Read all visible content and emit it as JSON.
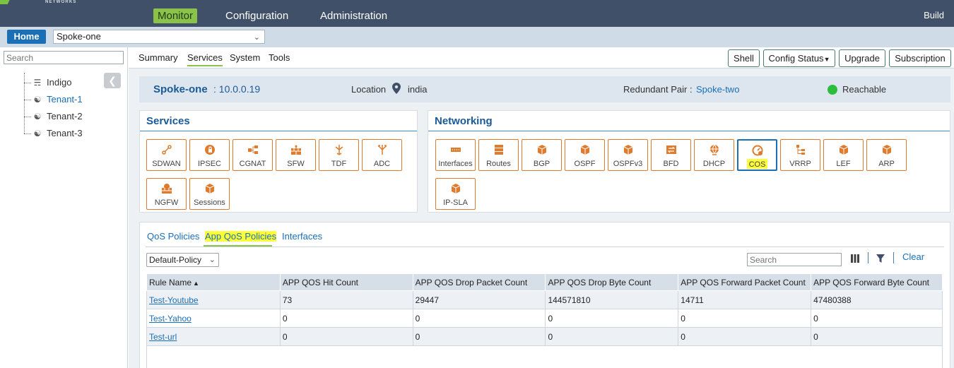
{
  "brand": {
    "logo_text": "NETWORKS",
    "accent": "#8bc34a",
    "logo_color": "#7cc242"
  },
  "topnav": {
    "items": [
      {
        "label": "Monitor",
        "active": true
      },
      {
        "label": "Configuration",
        "active": false
      },
      {
        "label": "Administration",
        "active": false
      }
    ],
    "build_label": "Build"
  },
  "homerow": {
    "home_label": "Home",
    "device_selected": "Spoke-one"
  },
  "tree": {
    "search_placeholder": "Search",
    "items": [
      {
        "label": "Indigo",
        "icon": "org-icon",
        "selected": false
      },
      {
        "label": "Tenant-1",
        "icon": "tenant-icon",
        "selected": true
      },
      {
        "label": "Tenant-2",
        "icon": "tenant-icon",
        "selected": false
      },
      {
        "label": "Tenant-3",
        "icon": "tenant-icon",
        "selected": false
      }
    ]
  },
  "subnav": {
    "tabs": [
      {
        "label": "Summary",
        "active": false
      },
      {
        "label": "Services",
        "active": true
      },
      {
        "label": "System",
        "active": false
      },
      {
        "label": "Tools",
        "active": false
      }
    ],
    "buttons": {
      "shell": "Shell",
      "config_status": "Config Status",
      "upgrade": "Upgrade",
      "subscription": "Subscription"
    }
  },
  "device": {
    "name": "Spoke-one",
    "ip": ": 10.0.0.19",
    "location_label": "Location",
    "location": "india",
    "redundant_label": "Redundant Pair :",
    "redundant_pair": "Spoke-two",
    "status": "Reachable",
    "status_color": "#2dbd3c"
  },
  "services": {
    "title": "Services",
    "tiles": [
      "SDWAN",
      "IPSEC",
      "CGNAT",
      "SFW",
      "TDF",
      "ADC",
      "NGFW",
      "Sessions"
    ]
  },
  "networking": {
    "title": "Networking",
    "tiles": [
      "Interfaces",
      "Routes",
      "BGP",
      "OSPF",
      "OSPFv3",
      "BFD",
      "DHCP",
      "COS",
      "VRRP",
      "LEF",
      "ARP",
      "IP-SLA"
    ],
    "active": "COS"
  },
  "qos": {
    "tabs": [
      "QoS Policies",
      "App QoS Policies",
      "Interfaces"
    ],
    "active_tab": "App QoS Policies",
    "policy_selected": "Default-Policy",
    "search_placeholder": "Search",
    "clear_label": "Clear",
    "columns": [
      "Rule Name",
      "APP QOS Hit Count",
      "APP QOS Drop Packet Count",
      "APP QOS Drop Byte Count",
      "APP QOS Forward Packet Count",
      "APP QOS Forward Byte Count"
    ],
    "rows": [
      [
        "Test-Youtube",
        "73",
        "29447",
        "144571810",
        "14711",
        "47480388"
      ],
      [
        "Test-Yahoo",
        "0",
        "0",
        "0",
        "0",
        "0"
      ],
      [
        "Test-url",
        "0",
        "0",
        "0",
        "0",
        "0"
      ]
    ]
  }
}
